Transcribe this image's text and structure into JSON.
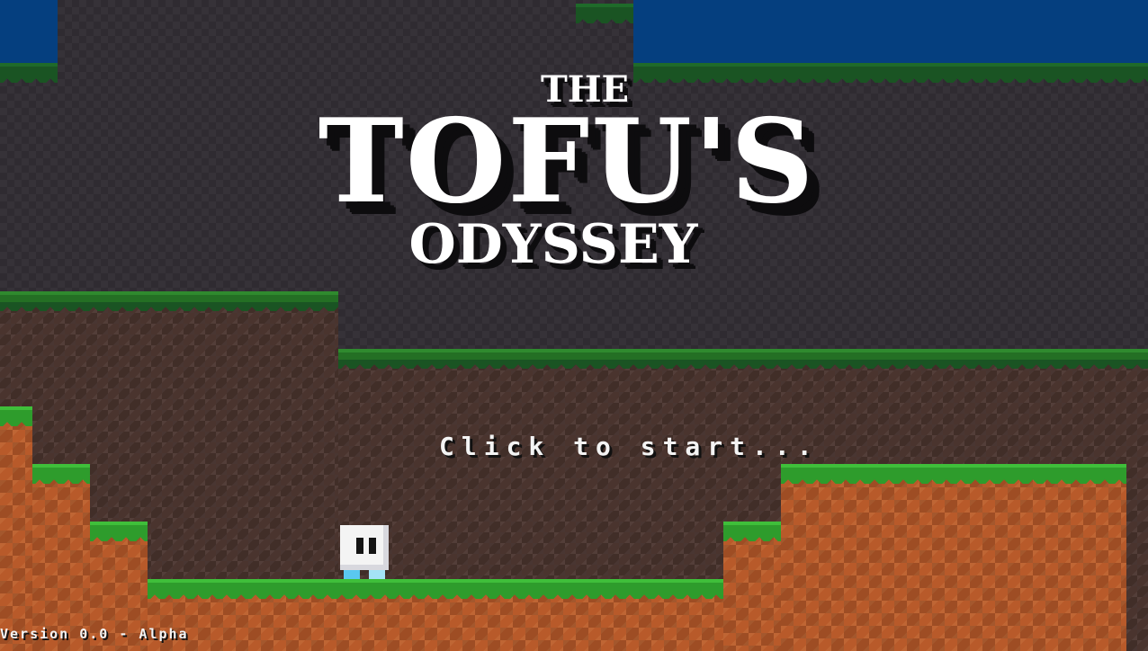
{
  "game": {
    "title_line1": "THE",
    "title_line2": "TOFU'S",
    "title_line3": "ODYSSEY",
    "start_prompt": "Click to start...",
    "version_label": "Version 0.0 - Alpha"
  },
  "colors": {
    "sky": "#053f7f",
    "cave_background": "#2f2b31",
    "grass_light": "#3fbf3a",
    "grass_dark": "#2e9c2c",
    "dirt_back": "#4a342e",
    "dirt_front": "#b85a2a",
    "title_text": "#ffffff",
    "title_shadow": "#0d0c0e"
  },
  "player": {
    "character": "tofu",
    "body_color": "#f4f4f4",
    "feet_color": "#5ac8f0"
  }
}
